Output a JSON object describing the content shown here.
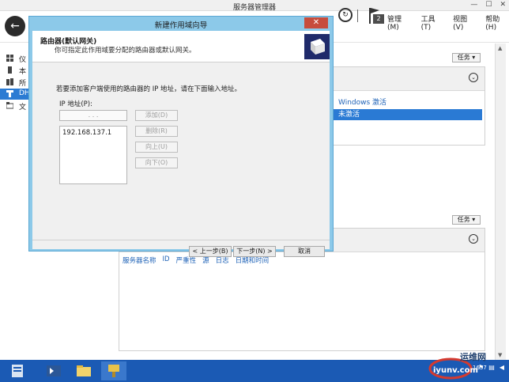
{
  "server_manager": {
    "title": "服务器管理器",
    "menus": [
      "管理(M)",
      "工具(T)",
      "视图(V)",
      "帮助(H)"
    ],
    "notification_count": "2",
    "nav_items": [
      {
        "label": "仪"
      },
      {
        "label": "本"
      },
      {
        "label": "所"
      },
      {
        "label": "DH"
      },
      {
        "label": "文"
      }
    ],
    "tasks_label": "任务",
    "windows_activation": "Windows 激活",
    "selected_row_text": "未激活",
    "event_columns": [
      "服务器名称",
      "ID",
      "严重性",
      "源",
      "日志",
      "日期和时间"
    ]
  },
  "dialog": {
    "title": "新建作用域向导",
    "close_symbol": "✕",
    "heading": "路由器(默认网关)",
    "subheading": "你可指定此作用域要分配的路由器或默认网关。",
    "instruction": "若要添加客户端使用的路由器的 IP 地址，请在下面输入地址。",
    "ip_label": "IP 地址(P):",
    "ip_placeholder": ". . .",
    "ip_list": [
      "192.168.137.1"
    ],
    "side_buttons": [
      "添加(D)",
      "删除(R)",
      "向上(U)",
      "向下(O)"
    ],
    "back_button": "< 上一步(B)",
    "next_button": "下一步(N) >",
    "cancel_button": "取消"
  },
  "taskbar": {
    "time": "1637",
    "watermark_top": "运维网",
    "watermark_bottom": "iyunv.com"
  }
}
